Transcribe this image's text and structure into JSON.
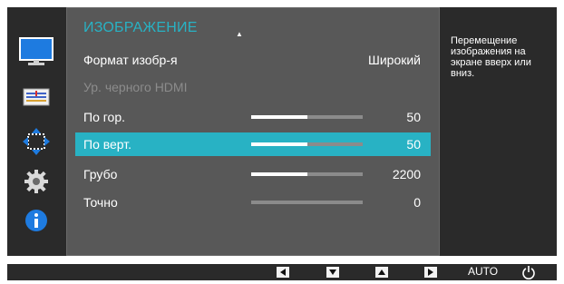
{
  "menu": {
    "title": "ИЗОБРАЖЕНИЕ",
    "rows": [
      {
        "label": "Формат изобр-я",
        "value": "Широкий",
        "state": "normal"
      },
      {
        "label": "Ур. черного HDMI",
        "value": "",
        "state": "disabled"
      },
      {
        "label": "По гор.",
        "value": "50",
        "level": 0.5,
        "state": "normal"
      },
      {
        "label": "По верт.",
        "value": "50",
        "level": 0.5,
        "state": "selected"
      },
      {
        "label": "Грубо",
        "value": "2200",
        "level": 0.5,
        "state": "normal"
      },
      {
        "label": "Точно",
        "value": "0",
        "level": 0.0,
        "state": "normal"
      }
    ]
  },
  "info": {
    "text": "Перемещение изображения на экране вверх или вниз."
  },
  "left_icons": [
    "monitor-icon",
    "color-adjust-icon",
    "position-arrows-icon",
    "gear-icon",
    "info-icon"
  ],
  "bottom_bar": {
    "buttons": [
      "left-arrow-icon",
      "down-arrow-icon",
      "up-arrow-icon",
      "right-arrow-icon"
    ],
    "auto_label": "AUTO",
    "power_icon": "power-icon"
  },
  "colors": {
    "accent": "#28b2c4",
    "panel": "#585858",
    "background": "#2a2a2a",
    "info_icon": "#1e7be0"
  }
}
